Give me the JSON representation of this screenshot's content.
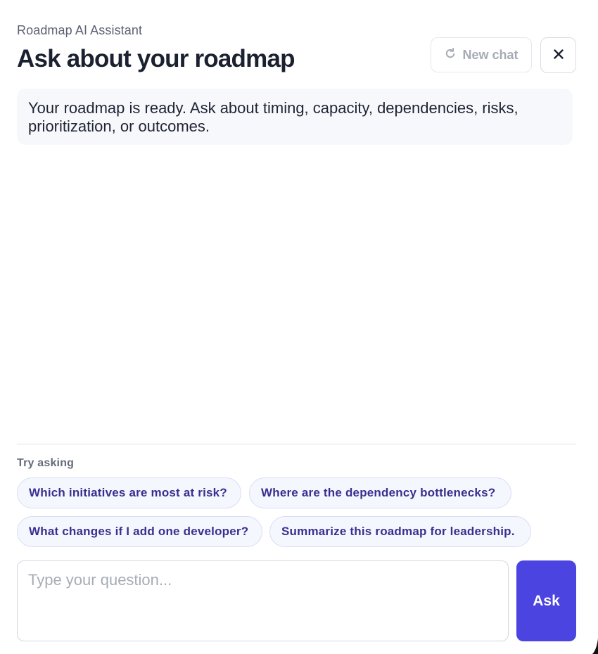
{
  "header": {
    "eyebrow": "Roadmap AI Assistant",
    "title": "Ask about your roadmap",
    "new_chat_label": "New chat",
    "new_chat_icon": "refresh-icon",
    "close_icon": "close-icon"
  },
  "messages": [
    {
      "role": "assistant",
      "text": "Your roadmap is ready. Ask about timing, capacity, dependencies, risks, prioritization, or outcomes."
    }
  ],
  "suggestions": {
    "label": "Try asking",
    "items": [
      "Which initiatives are most at risk?",
      "Where are the dependency bottlenecks?",
      "What changes if I add one developer?",
      "Summarize this roadmap for leadership."
    ]
  },
  "composer": {
    "placeholder": "Type your question...",
    "value": "",
    "submit_label": "Ask"
  },
  "colors": {
    "accent": "#4b44e0",
    "chip_text": "#3a2f8f",
    "chip_bg": "#f5f7fe",
    "bubble_bg": "#f6f8fc"
  }
}
